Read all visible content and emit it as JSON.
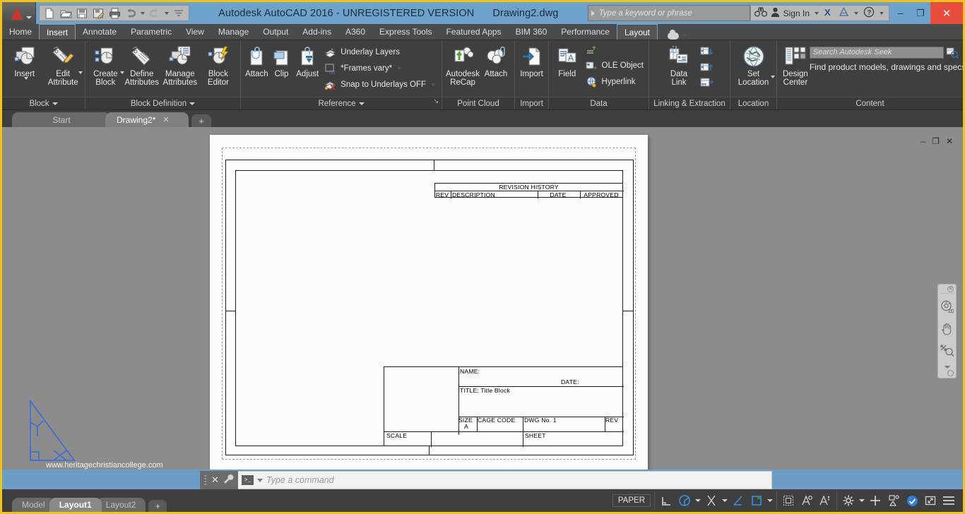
{
  "window": {
    "title": "Autodesk AutoCAD 2016 - UNREGISTERED VERSION",
    "document": "Drawing2.dwg",
    "minimize": "–",
    "maximize": "❐",
    "close": "✕"
  },
  "quick_access": {
    "items": [
      {
        "name": "new-icon",
        "label": "New"
      },
      {
        "name": "open-icon",
        "label": "Open"
      },
      {
        "name": "save-icon",
        "label": "Save"
      },
      {
        "name": "save-as-icon",
        "label": "Save As"
      },
      {
        "name": "plot-icon",
        "label": "Plot"
      },
      {
        "name": "undo-icon",
        "label": "Undo"
      },
      {
        "name": "redo-icon",
        "label": "Redo"
      },
      {
        "name": "qat-more-icon",
        "label": "Customize"
      }
    ]
  },
  "infocenter": {
    "placeholder": "Type a keyword or phrase",
    "search_icon": "binoculars-icon",
    "sign_in": "Sign In",
    "exchange_icon": "autodesk-exchange-icon",
    "share_icon": "share-icon",
    "help_icon": "help-icon"
  },
  "ribbon_tabs": [
    {
      "label": "Home",
      "active": false
    },
    {
      "label": "Insert",
      "active": true
    },
    {
      "label": "Annotate",
      "active": false
    },
    {
      "label": "Parametric",
      "active": false
    },
    {
      "label": "View",
      "active": false
    },
    {
      "label": "Manage",
      "active": false
    },
    {
      "label": "Output",
      "active": false
    },
    {
      "label": "Add-ins",
      "active": false
    },
    {
      "label": "A360",
      "active": false
    },
    {
      "label": "Express Tools",
      "active": false
    },
    {
      "label": "Featured Apps",
      "active": false
    },
    {
      "label": "BIM 360",
      "active": false
    },
    {
      "label": "Performance",
      "active": false
    },
    {
      "label": "Layout",
      "active": true
    }
  ],
  "panels": {
    "block": {
      "title": "Block",
      "buttons": [
        {
          "label": "Insert",
          "icon": "insert-block-icon",
          "dropdown": true
        },
        {
          "label": "Edit\nAttribute",
          "icon": "edit-attribute-icon",
          "dropdown": true
        }
      ]
    },
    "block_definition": {
      "title": "Block Definition",
      "buttons": [
        {
          "label": "Create\nBlock",
          "icon": "create-block-icon",
          "dropdown": true
        },
        {
          "label": "Define\nAttributes",
          "icon": "define-attributes-icon",
          "dropdown": false
        },
        {
          "label": "Manage\nAttributes",
          "icon": "manage-attributes-icon",
          "dropdown": false
        },
        {
          "label": "Block\nEditor",
          "icon": "block-editor-icon",
          "dropdown": false
        }
      ]
    },
    "reference": {
      "title": "Reference",
      "buttons": [
        {
          "label": "Attach",
          "icon": "attach-icon",
          "dropdown": false
        },
        {
          "label": "Clip",
          "icon": "clip-icon",
          "dropdown": false
        },
        {
          "label": "Adjust",
          "icon": "adjust-icon",
          "dropdown": false
        }
      ],
      "small_buttons": [
        {
          "label": "Underlay Layers",
          "icon": "underlay-layers-icon",
          "dropdown": false
        },
        {
          "label": "*Frames vary*",
          "icon": "frames-vary-icon",
          "dropdown": true
        },
        {
          "label": "Snap to Underlays OFF",
          "icon": "snap-underlays-icon",
          "dropdown": true
        }
      ]
    },
    "point_cloud": {
      "title": "Point Cloud",
      "buttons": [
        {
          "label": "Autodesk\nReCap",
          "icon": "autodesk-recap-icon",
          "dropdown": false
        },
        {
          "label": "Attach",
          "icon": "point-cloud-attach-icon",
          "dropdown": false
        }
      ]
    },
    "import": {
      "title": "Import",
      "buttons": [
        {
          "label": "Import",
          "icon": "import-icon",
          "dropdown": false
        }
      ]
    },
    "data": {
      "title": "Data",
      "buttons": [
        {
          "label": "Field",
          "icon": "field-icon",
          "dropdown": false
        }
      ],
      "small_buttons": [
        {
          "label": "",
          "icon": "data-extract-icon",
          "dropdown": false
        },
        {
          "label": "OLE Object",
          "icon": "ole-object-icon",
          "dropdown": false
        },
        {
          "label": "Hyperlink",
          "icon": "hyperlink-icon",
          "dropdown": false
        }
      ]
    },
    "linking": {
      "title": "Linking & Extraction",
      "buttons": [
        {
          "label": "Data\nLink",
          "icon": "data-link-icon",
          "dropdown": false
        }
      ],
      "small_buttons": [
        {
          "label": "",
          "icon": "download-from-source-icon",
          "dropdown": false
        },
        {
          "label": "",
          "icon": "upload-to-source-icon",
          "dropdown": false
        },
        {
          "label": "",
          "icon": "extract-data-icon",
          "dropdown": false
        }
      ]
    },
    "location": {
      "title": "Location",
      "buttons": [
        {
          "label": "Set\nLocation",
          "icon": "set-location-globe-icon",
          "dropdown": true
        }
      ]
    },
    "content": {
      "title": "Content",
      "buttons": [
        {
          "label": "Design\nCenter",
          "icon": "design-center-icon",
          "dropdown": false
        }
      ],
      "seek_placeholder": "Search Autodesk Seek",
      "seek_button_icon": "seek-search-icon",
      "seek_note": "Find product models, drawings and specs"
    }
  },
  "file_tabs": [
    {
      "label": "Start",
      "active": false,
      "closable": false
    },
    {
      "label": "Drawing2*",
      "active": true,
      "closable": true
    }
  ],
  "file_tab_add": "+",
  "drawing": {
    "revision_history": {
      "title": "REVISION  HISTORY",
      "columns": [
        "REV",
        "DESCRIPTION",
        "DATE",
        "APPROVED"
      ]
    },
    "title_block": {
      "name_label": "NAME:",
      "date_label": "DATE:",
      "title_label": "TITLE: Title  Block",
      "size_label": "SIZE",
      "size_value": "A",
      "cage_code_label": "CAGE  CODE",
      "dwg_no_label": "DWG  No.  1",
      "rev_label": "REV",
      "scale_label": "SCALE",
      "sheet_label": "SHEET"
    },
    "watermark": "www.heritagechristiancollege.com"
  },
  "viewport_buttons": {
    "minimize": "–",
    "restore": "❐",
    "close": "✕"
  },
  "navbar": {
    "items": [
      {
        "name": "steering-wheel-2d-icon",
        "label": "2D"
      },
      {
        "name": "pan-hand-icon",
        "label": "Pan"
      },
      {
        "name": "zoom-extents-icon",
        "label": "Zoom"
      }
    ]
  },
  "command_line": {
    "placeholder": "Type  a  command",
    "close_icon": "close-icon",
    "settings_icon": "wrench-icon",
    "prompt_icon": "command-prompt-icon"
  },
  "layout_tabs": [
    {
      "label": "Model",
      "active": false
    },
    {
      "label": "Layout1",
      "active": true
    },
    {
      "label": "Layout2",
      "active": false
    }
  ],
  "layout_tab_add": "+",
  "status_bar": {
    "space": "PAPER",
    "groups": [
      {
        "items": [
          {
            "name": "ortho-icon"
          },
          {
            "name": "polar-tracking-icon",
            "dropdown": true
          },
          {
            "name": "osnap-icon",
            "dropdown": true
          },
          {
            "name": "otrack-icon"
          },
          {
            "name": "workspace-icon",
            "dropdown": true
          }
        ]
      },
      {
        "items": [
          {
            "name": "annotation-visibility-icon"
          },
          {
            "name": "annotation-scale-auto-icon"
          },
          {
            "name": "annotation-scale-add-icon"
          }
        ]
      },
      {
        "items": [
          {
            "name": "settings-gear-icon",
            "dropdown": true
          },
          {
            "name": "customize-plus-icon"
          },
          {
            "name": "isolate-objects-icon"
          },
          {
            "name": "hardware-accel-icon"
          },
          {
            "name": "clean-screen-icon"
          },
          {
            "name": "customization-menu-icon"
          }
        ]
      }
    ]
  },
  "colors": {
    "title_bar": "#6da2cc",
    "ribbon": "#3f3f3f",
    "canvas": "#8c8c8c",
    "accent_blue": "#3b7fd4",
    "window_border": "#f0c419",
    "close_red": "#e74c3c"
  }
}
